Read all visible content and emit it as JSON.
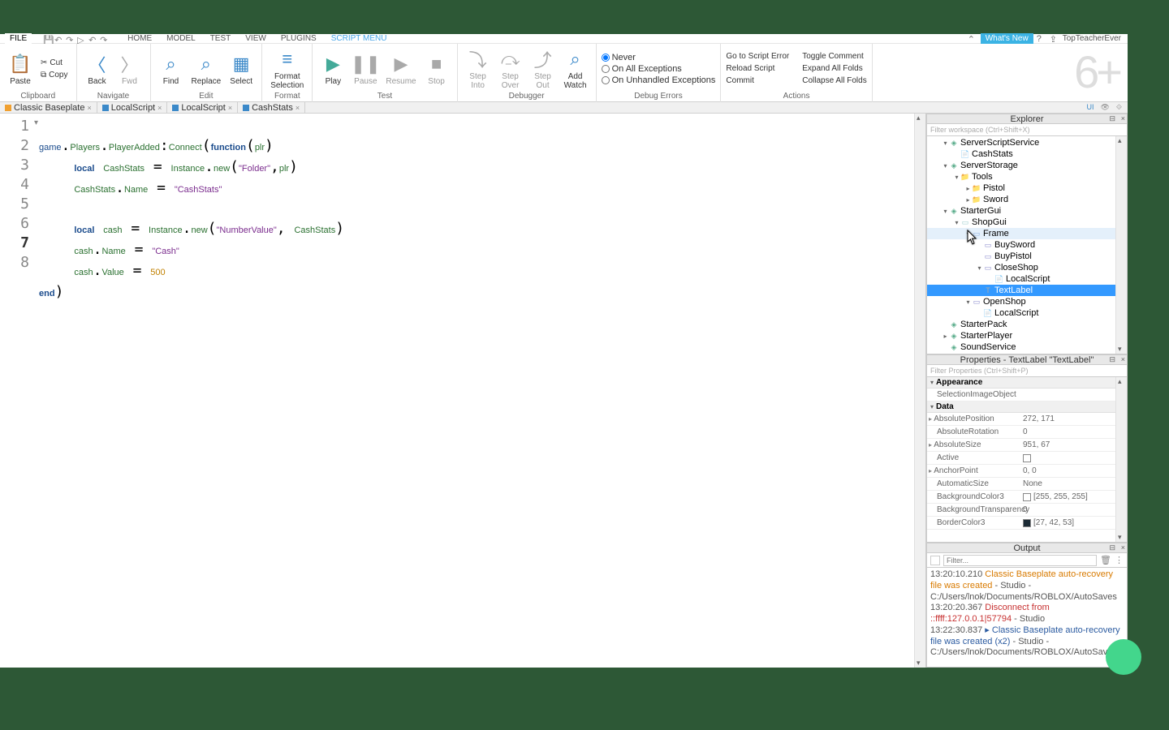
{
  "menubar": {
    "file": "FILE",
    "tabs": [
      "HOME",
      "MODEL",
      "TEST",
      "VIEW",
      "PLUGINS",
      "SCRIPT MENU"
    ],
    "active_tab": 5,
    "whatsnew": "What's New",
    "user": "TopTeacherEver"
  },
  "ribbon": {
    "clipboard": {
      "paste": "Paste",
      "cut": "Cut",
      "copy": "Copy",
      "label": "Clipboard"
    },
    "navigate": {
      "back": "Back",
      "fwd": "Fwd",
      "label": "Navigate"
    },
    "edit": {
      "find": "Find",
      "replace": "Replace",
      "select": "Select",
      "label": "Edit"
    },
    "format": {
      "btn": "Format\nSelection",
      "label": "Format"
    },
    "test": {
      "play": "Play",
      "pause": "Pause",
      "resume": "Resume",
      "stop": "Stop",
      "label": "Test"
    },
    "debugger": {
      "stepinto": "Step\nInto",
      "stepover": "Step\nOver",
      "stepout": "Step\nOut",
      "addwatch": "Add\nWatch",
      "label": "Debugger"
    },
    "debugerr": {
      "never": "Never",
      "onallex": "On All Exceptions",
      "onunh": "On Unhandled Exceptions",
      "label": "Debug Errors"
    },
    "actions": {
      "gotoerr": "Go to Script Error",
      "reload": "Reload Script",
      "commit": "Commit",
      "toggle": "Toggle Comment",
      "expand": "Expand All Folds",
      "collapse": "Collapse All Folds",
      "label": "Actions"
    },
    "watermark": "6+"
  },
  "scripttabs": {
    "tabs": [
      {
        "label": "Classic Baseplate",
        "icon": "f"
      },
      {
        "label": "LocalScript",
        "icon": "s"
      },
      {
        "label": "LocalScript",
        "icon": "s"
      },
      {
        "label": "CashStats",
        "icon": "s"
      }
    ],
    "right": [
      "UI",
      "👁",
      "⟐"
    ]
  },
  "editor": {
    "lines": [
      1,
      2,
      3,
      4,
      5,
      6,
      7,
      8
    ],
    "current_line": 7
  },
  "explorer": {
    "title": "Explorer",
    "filter_placeholder": "Filter workspace (Ctrl+Shift+X)",
    "tree": [
      {
        "d": 1,
        "ar": "▾",
        "ic": "srv",
        "label": "ServerScriptService"
      },
      {
        "d": 2,
        "ar": "",
        "ic": "scr",
        "label": "CashStats"
      },
      {
        "d": 1,
        "ar": "▾",
        "ic": "srv",
        "label": "ServerStorage"
      },
      {
        "d": 2,
        "ar": "▾",
        "ic": "fld",
        "label": "Tools"
      },
      {
        "d": 3,
        "ar": "▸",
        "ic": "fld",
        "label": "Pistol"
      },
      {
        "d": 3,
        "ar": "▸",
        "ic": "fld",
        "label": "Sword"
      },
      {
        "d": 1,
        "ar": "▾",
        "ic": "srv",
        "label": "StarterGui"
      },
      {
        "d": 2,
        "ar": "▾",
        "ic": "gui",
        "label": "ShopGui"
      },
      {
        "d": 3,
        "ar": "▾",
        "ic": "frm",
        "label": "Frame",
        "hov": true
      },
      {
        "d": 4,
        "ar": "",
        "ic": "btn",
        "label": "BuySword"
      },
      {
        "d": 4,
        "ar": "",
        "ic": "btn",
        "label": "BuyPistol"
      },
      {
        "d": 4,
        "ar": "▾",
        "ic": "btn",
        "label": "CloseShop"
      },
      {
        "d": 5,
        "ar": "",
        "ic": "scr",
        "label": "LocalScript"
      },
      {
        "d": 4,
        "ar": "",
        "ic": "txt",
        "label": "TextLabel",
        "sel": true
      },
      {
        "d": 3,
        "ar": "▾",
        "ic": "btn",
        "label": "OpenShop"
      },
      {
        "d": 4,
        "ar": "",
        "ic": "scr",
        "label": "LocalScript"
      },
      {
        "d": 1,
        "ar": "",
        "ic": "srv",
        "label": "StarterPack"
      },
      {
        "d": 1,
        "ar": "▸",
        "ic": "srv",
        "label": "StarterPlayer"
      },
      {
        "d": 1,
        "ar": "",
        "ic": "srv",
        "label": "SoundService"
      }
    ]
  },
  "properties": {
    "title": "Properties - TextLabel \"TextLabel\"",
    "filter_placeholder": "Filter Properties (Ctrl+Shift+P)",
    "groups": [
      {
        "name": "Appearance",
        "rows": [
          {
            "n": "SelectionImageObject",
            "v": ""
          }
        ]
      },
      {
        "name": "Data",
        "rows": [
          {
            "n": "AbsolutePosition",
            "v": "272, 171",
            "exp": true
          },
          {
            "n": "AbsoluteRotation",
            "v": "0"
          },
          {
            "n": "AbsoluteSize",
            "v": "951, 67",
            "exp": true
          },
          {
            "n": "Active",
            "v": "",
            "check": true
          },
          {
            "n": "AnchorPoint",
            "v": "0, 0",
            "exp": true
          },
          {
            "n": "AutomaticSize",
            "v": "None"
          },
          {
            "n": "BackgroundColor3",
            "v": "[255, 255, 255]",
            "swatch": "#ffffff"
          },
          {
            "n": "BackgroundTransparency",
            "v": "0"
          },
          {
            "n": "BorderColor3",
            "v": "[27, 42, 53]",
            "swatch": "#1b2a35"
          }
        ]
      }
    ]
  },
  "output": {
    "title": "Output",
    "filter_placeholder": "Filter...",
    "lines": [
      {
        "ts": "13:20:10.210",
        "cls": "warn",
        "txt": "Classic Baseplate auto-recovery file was created",
        "tail": " - Studio - C:/Users/lnok/Documents/ROBLOX/AutoSaves"
      },
      {
        "ts": "13:20:20.367",
        "cls": "err",
        "txt": "Disconnect from ::ffff:127.0.0.1|57794",
        "tail": " - Studio"
      },
      {
        "ts": "13:22:30.837",
        "cls": "inf",
        "txt": "▸ Classic Baseplate auto-recovery file was created (x2)",
        "tail": " - Studio - C:/Users/lnok/Documents/ROBLOX/AutoSaves"
      }
    ]
  }
}
